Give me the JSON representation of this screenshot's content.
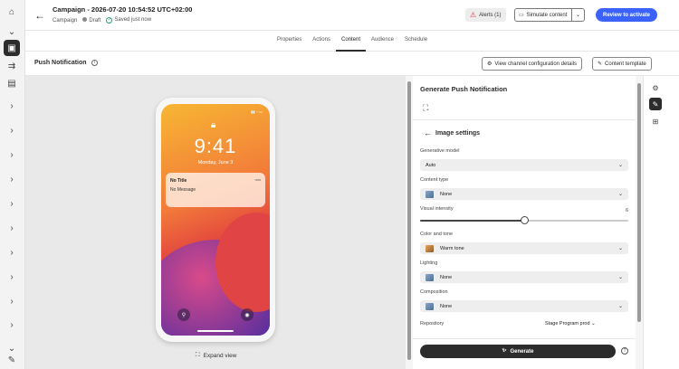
{
  "header": {
    "title": "Campaign - 2026-07-20 10:54:52 UTC+02:00",
    "breadcrumb": "Campaign",
    "status": "Draft",
    "saved": "Saved just now",
    "alerts_label": "Alerts (1)",
    "simulate_label": "Simulate content",
    "review_label": "Review to activate"
  },
  "tabs": [
    "Properties",
    "Actions",
    "Content",
    "Audience",
    "Schedule"
  ],
  "active_tab": "Content",
  "channel": {
    "title": "Push Notification",
    "view_config_label": "View channel configuration details",
    "content_template_label": "Content template"
  },
  "preview": {
    "time": "9:41",
    "date": "Monday, June 3",
    "notif_title": "No Title",
    "notif_message": "No Message",
    "notif_time": "now",
    "expand_label": "Expand view"
  },
  "panel": {
    "title": "Generate Push Notification",
    "section_title": "Image settings",
    "generative_model_label": "Generative model",
    "generative_model_value": "Auto",
    "content_type_label": "Content type",
    "content_type_value": "None",
    "visual_intensity_label": "Visual intensity",
    "visual_intensity_value": "6",
    "visual_intensity_fraction": 0.5,
    "color_tone_label": "Color and tone",
    "color_tone_value": "Warm tone",
    "lighting_label": "Lighting",
    "lighting_value": "None",
    "composition_label": "Composition",
    "composition_value": "None",
    "repository_label": "Repository",
    "repository_value": "Stage Program prod",
    "generate_label": "Generate"
  },
  "icons": {
    "left_rail": [
      "home-icon",
      "chevron-down-icon",
      "campaign-icon",
      "journey-icon",
      "document-icon",
      "chevron-right-icon"
    ],
    "right_rail": [
      "settings-icon",
      "magic-wand-icon",
      "add-panel-icon"
    ]
  },
  "colors": {
    "primary": "#3b63fb",
    "dark": "#2c2c2c",
    "warning": "#d7373f",
    "success": "#2d9d78"
  }
}
